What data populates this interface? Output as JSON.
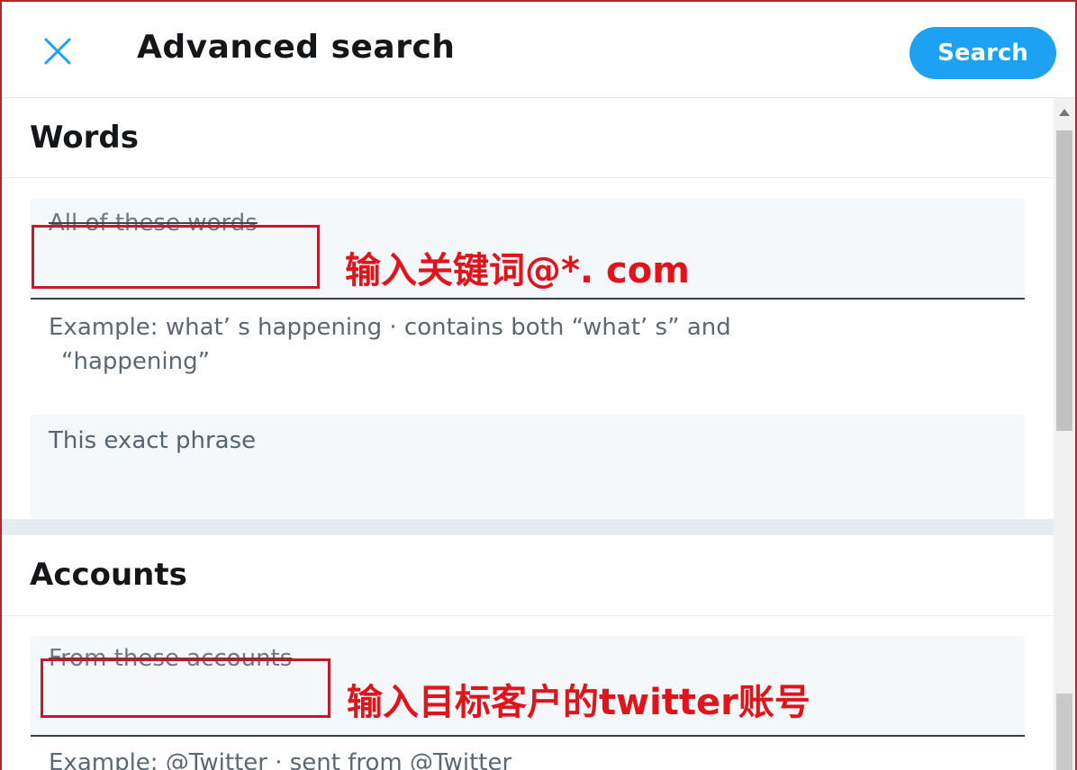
{
  "header": {
    "title": "Advanced search",
    "search_label": "Search"
  },
  "words": {
    "section_title": "Words",
    "all_words": {
      "label": "All of these words",
      "annotation": "输入关键词@*. com"
    },
    "all_words_hint_line1": "Example: what’ s happening · contains both  “what’ s”  and",
    "all_words_hint_line2": "“happening”",
    "exact_phrase": {
      "label": "This exact phrase"
    }
  },
  "accounts": {
    "section_title": "Accounts",
    "from_accounts": {
      "label": "From these accounts",
      "annotation": "输入目标客户的twitter账号"
    },
    "from_hint": "Example: @Twitter · sent from @Twitter"
  },
  "colors": {
    "accent": "#1da1f2",
    "annotation_red": "#e0141a",
    "highlight_box": "#c9172a"
  },
  "icons": {
    "close": "close-icon"
  }
}
